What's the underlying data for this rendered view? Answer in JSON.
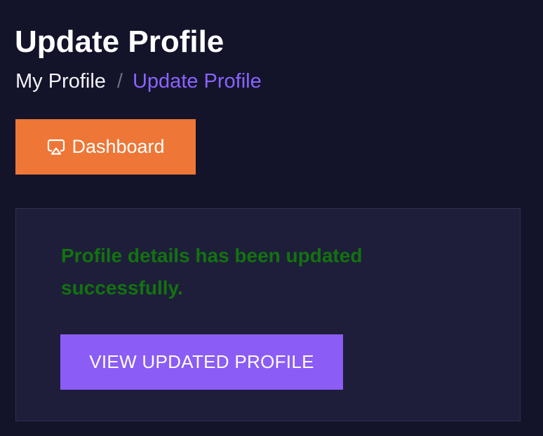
{
  "header": {
    "title": "Update Profile"
  },
  "breadcrumb": {
    "root": "My Profile",
    "separator": "/",
    "current": "Update Profile"
  },
  "dashboard_button": {
    "label": "Dashboard",
    "icon": "airplay-icon"
  },
  "card": {
    "message": "Profile details has been updated successfully.",
    "button_label": "VIEW UPDATED PROFILE"
  },
  "colors": {
    "background": "#13142a",
    "card": "#1e1e3a",
    "accent_orange": "#ee7636",
    "accent_purple": "#8b5cf6",
    "breadcrumb_active": "#8b63ff",
    "success_green": "#12730f"
  }
}
